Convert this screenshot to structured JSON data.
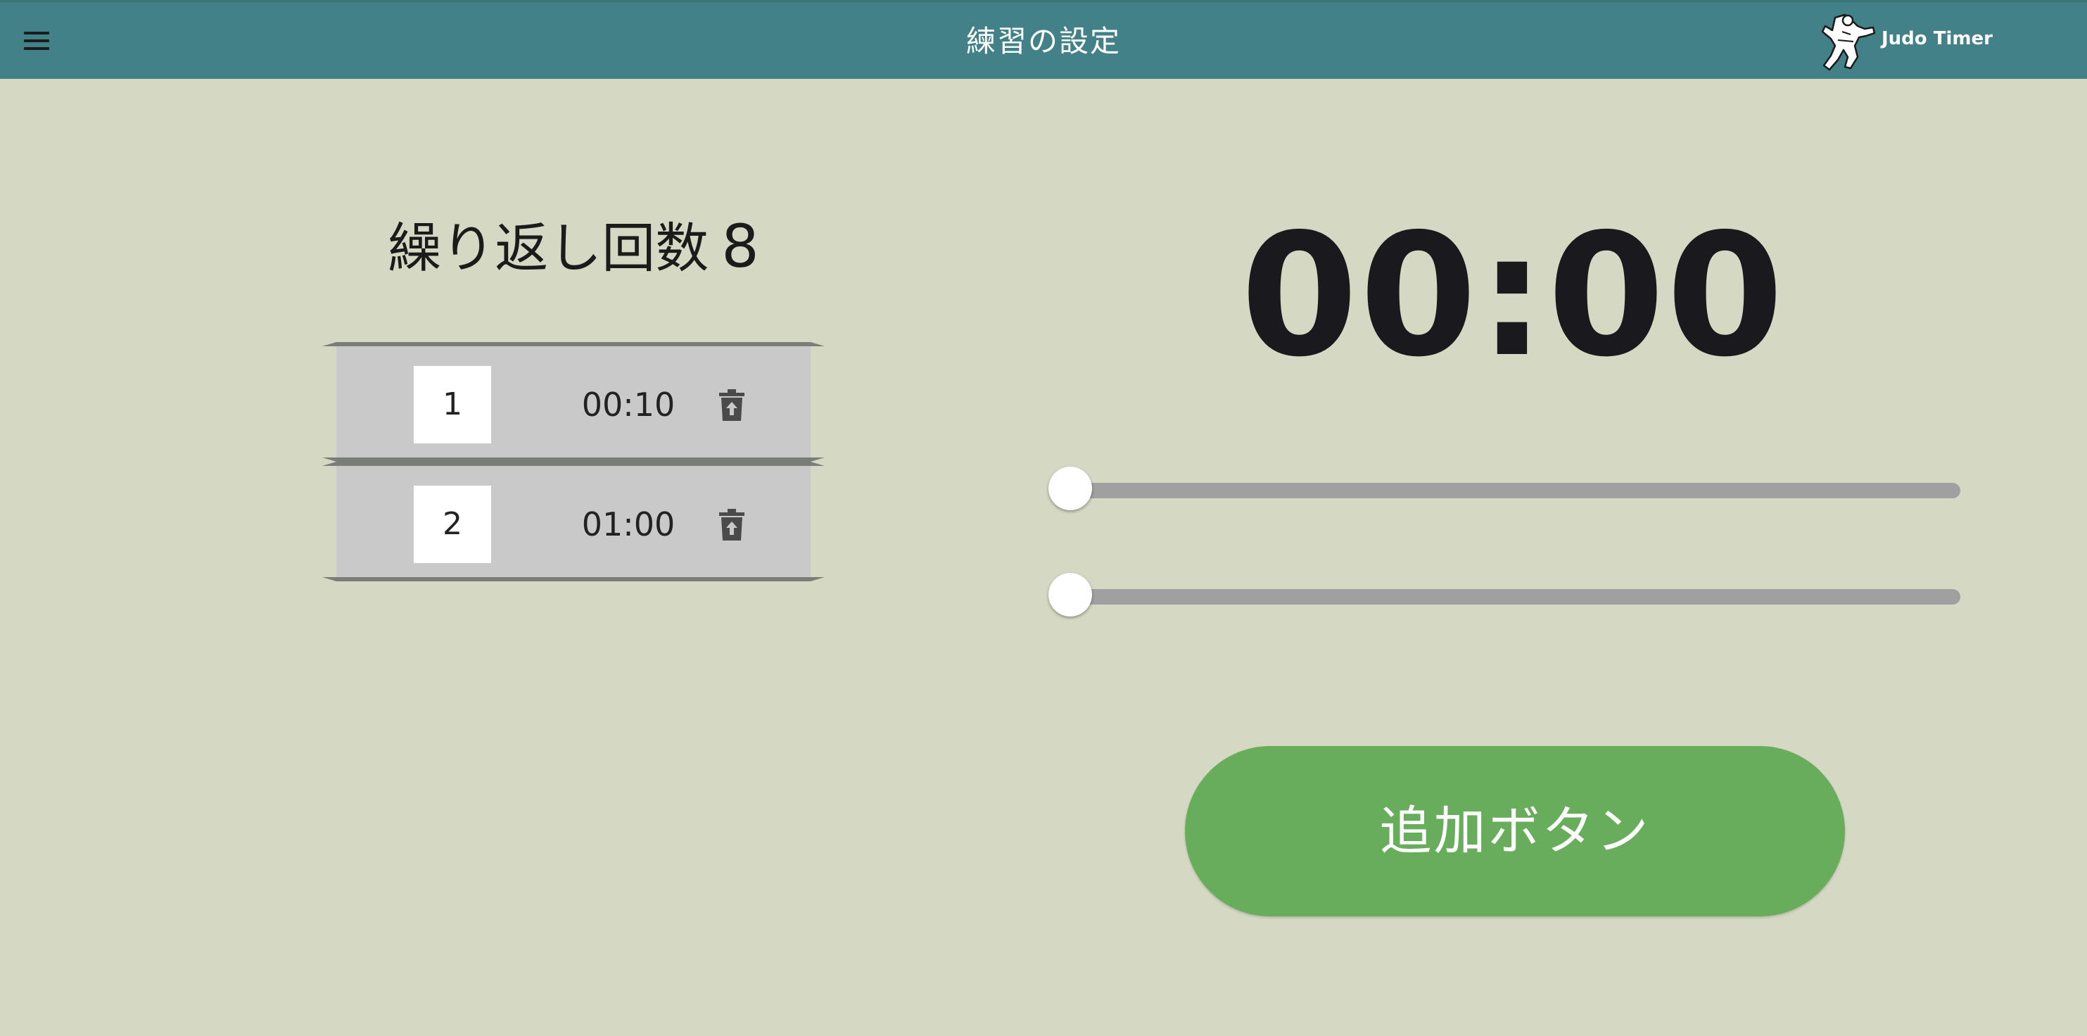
{
  "appbar": {
    "title": "練習の設定",
    "brand": "Judo Timer",
    "background": "#428187"
  },
  "repeat": {
    "label": "繰り返し回数",
    "count": "8"
  },
  "segments": [
    {
      "index": "1",
      "time": "00:10"
    },
    {
      "index": "2",
      "time": "01:00"
    }
  ],
  "timer": {
    "display": "00:00"
  },
  "sliders": [
    {
      "value": 0
    },
    {
      "value": 0
    }
  ],
  "add_button": {
    "label": "追加ボタン",
    "color": "#68ad5c"
  },
  "icons": {
    "menu": "menu-icon",
    "delete": "trash-icon",
    "logo": "judo-logo"
  }
}
